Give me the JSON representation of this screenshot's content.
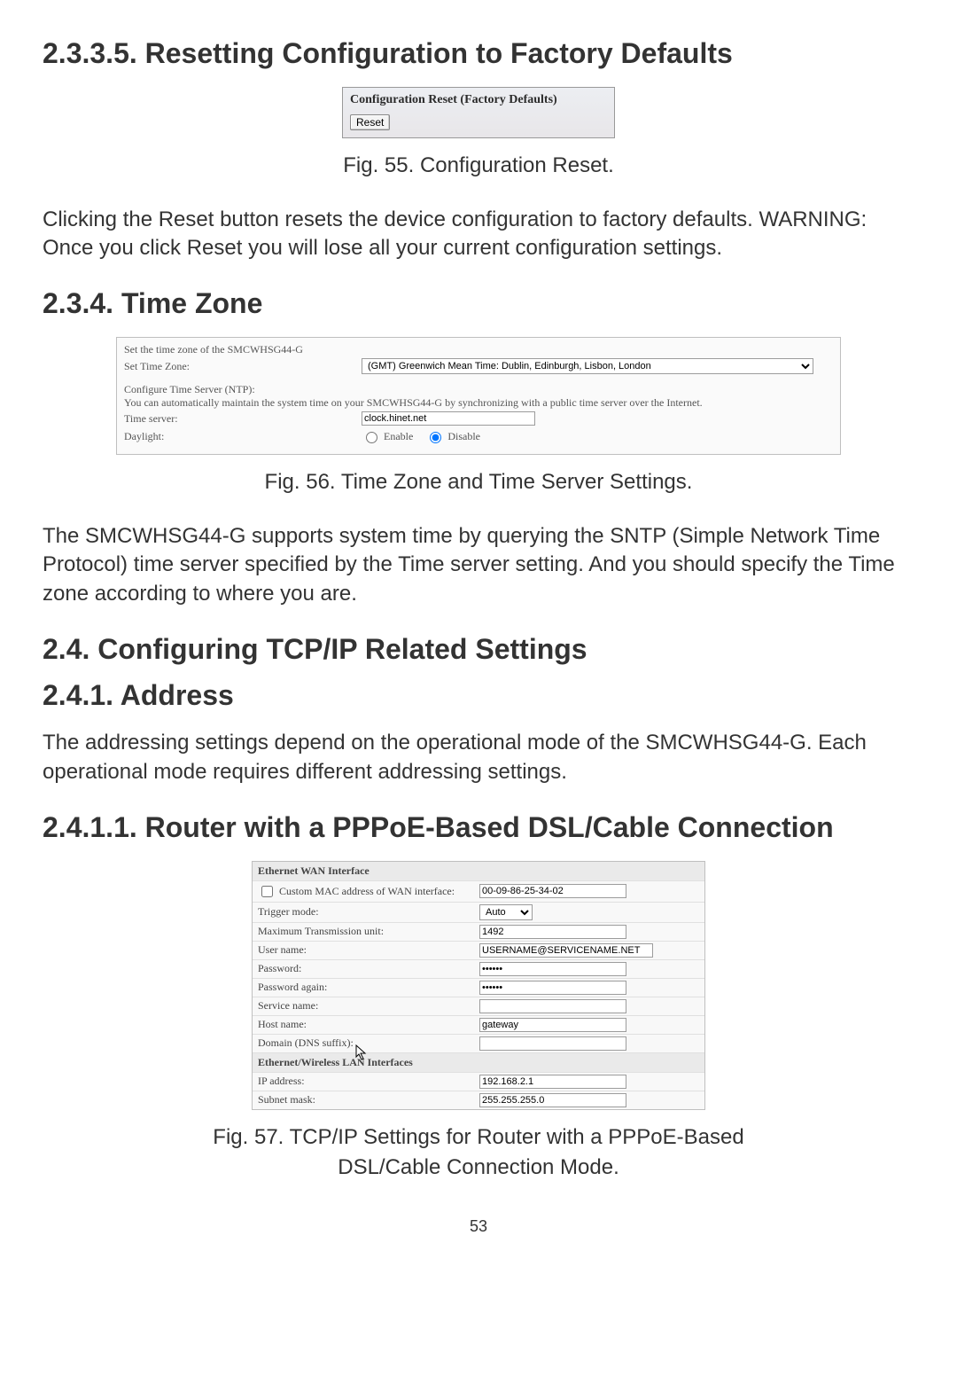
{
  "section_2_3_3_5_heading": "2.3.3.5. Resetting Configuration to Factory Defaults",
  "fig55": {
    "panel_title": "Configuration Reset (Factory Defaults)",
    "reset_button": "Reset",
    "caption": "Fig. 55. Configuration Reset."
  },
  "para_reset": "Clicking the Reset button resets the device configuration to factory defaults. WARNING: Once you click Reset you will lose all your current configuration settings.",
  "section_2_3_4_heading": "2.3.4. Time Zone",
  "fig56": {
    "intro": "Set the time zone of the SMCWHSG44-G",
    "set_tz_label": "Set Time Zone:",
    "tz_option": "(GMT) Greenwich Mean Time: Dublin, Edinburgh, Lisbon, London",
    "ntp_heading": "Configure Time Server (NTP):",
    "ntp_note": "You can automatically maintain the system time on your SMCWHSG44-G by synchronizing with a public time server over the Internet.",
    "time_server_label": "Time server:",
    "time_server_value": "clock.hinet.net",
    "daylight_label": "Daylight:",
    "enable": "Enable",
    "disable": "Disable",
    "caption": "Fig. 56. Time Zone and Time Server Settings."
  },
  "para_timezone": "The SMCWHSG44-G supports system time by querying the SNTP (Simple Network Time Protocol) time server specified by the Time server setting. And you should specify the Time zone according to where you are.",
  "section_2_4_heading": "2.4. Configuring TCP/IP Related Settings",
  "section_2_4_1_heading": "2.4.1. Address",
  "para_address": "The addressing settings depend on the operational mode of the SMCWHSG44-G. Each operational mode requires different addressing settings.",
  "section_2_4_1_1_heading": "2.4.1.1. Router with a PPPoE-Based DSL/Cable Connection",
  "fig57": {
    "wan_header": "Ethernet WAN Interface",
    "custom_mac_label": "Custom MAC address of WAN interface:",
    "custom_mac_value": "00-09-86-25-34-02",
    "trigger_mode_label": "Trigger mode:",
    "trigger_mode_value": "Auto",
    "mtu_label": "Maximum Transmission unit:",
    "mtu_value": "1492",
    "username_label": "User name:",
    "username_value": "USERNAME@SERVICENAME.NET",
    "password_label": "Password:",
    "password_value": "••••••",
    "password_again_label": "Password again:",
    "password_again_value": "••••••",
    "service_name_label": "Service name:",
    "service_name_value": "",
    "host_name_label": "Host name:",
    "host_name_value": "gateway",
    "dns_suffix_label": "Domain (DNS suffix):",
    "dns_suffix_value": "",
    "lan_header": "Ethernet/Wireless LAN Interfaces",
    "ip_label": "IP address:",
    "ip_value": "192.168.2.1",
    "subnet_label": "Subnet mask:",
    "subnet_value": "255.255.255.0",
    "caption_line1": "Fig. 57. TCP/IP Settings for Router with a PPPoE-Based",
    "caption_line2": "DSL/Cable Connection Mode."
  },
  "page_number": "53"
}
